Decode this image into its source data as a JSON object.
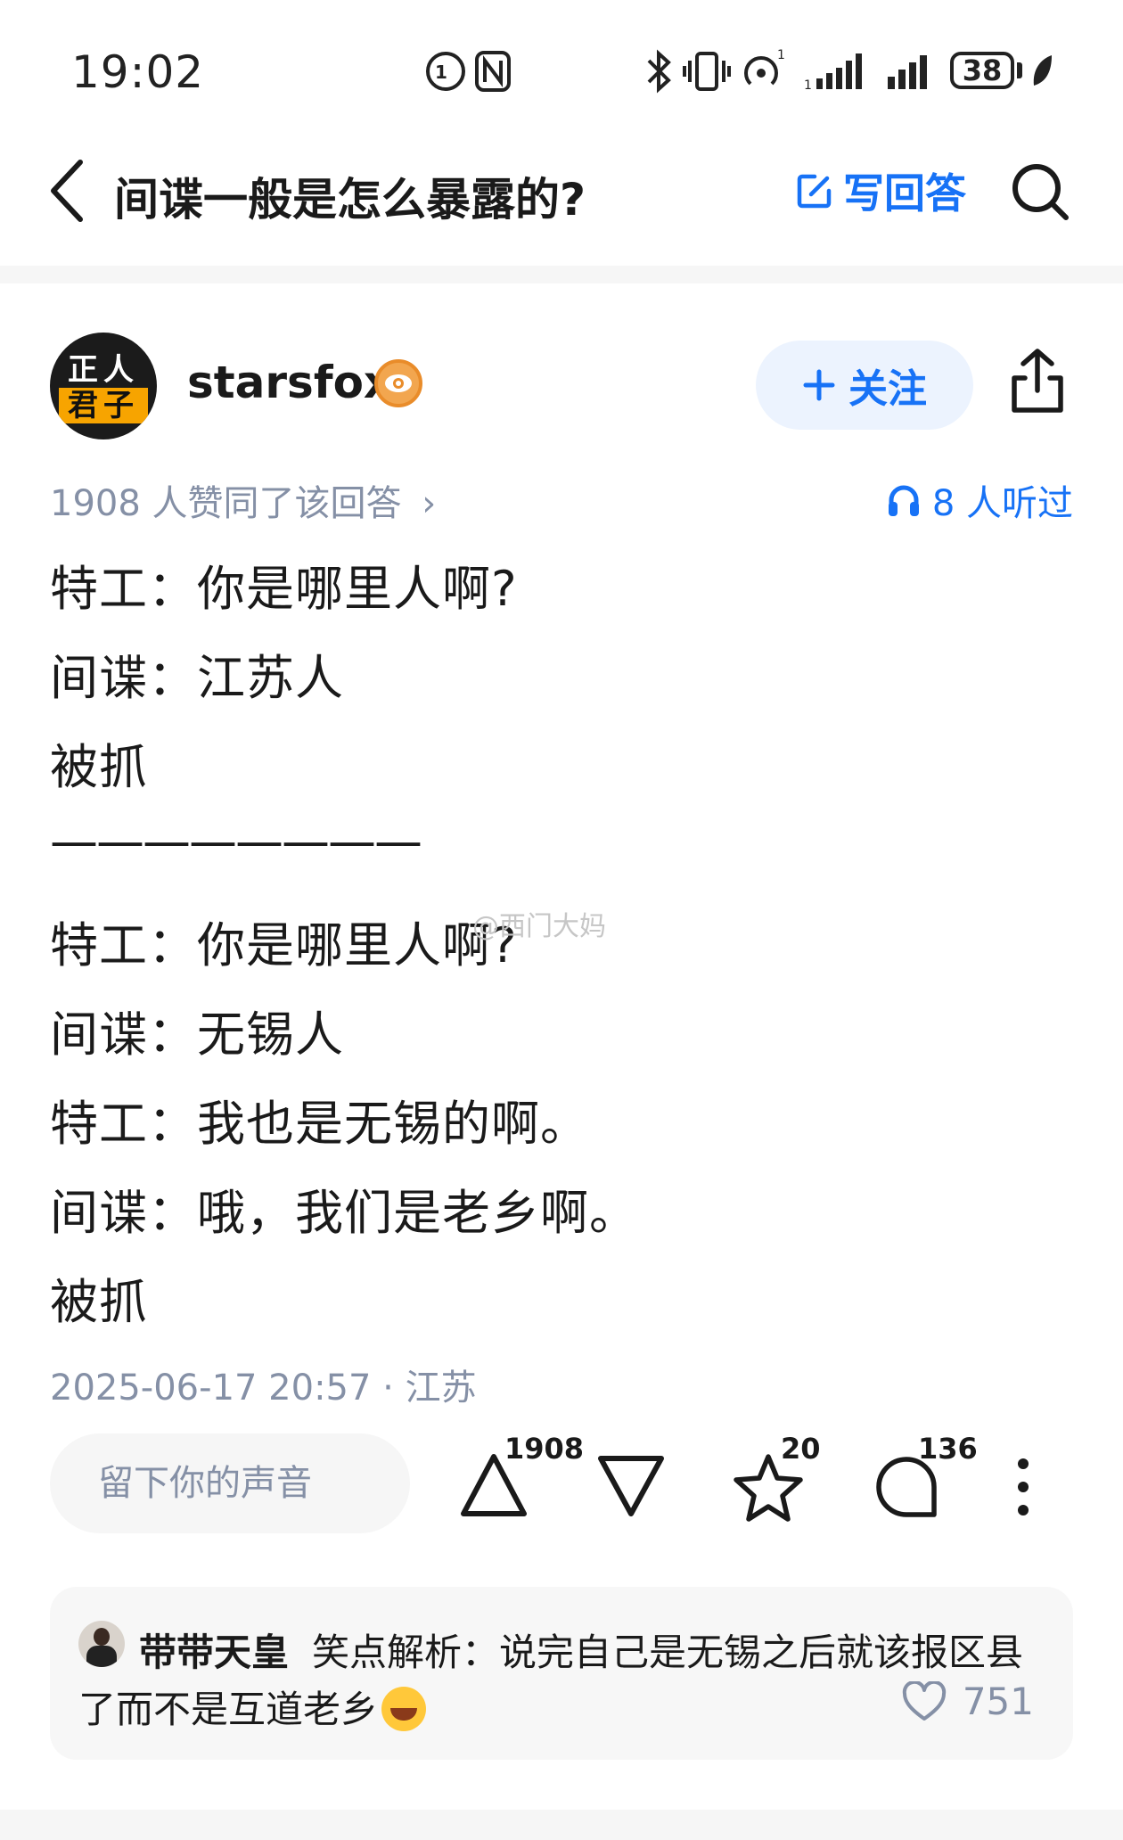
{
  "status_bar": {
    "time": "19:02",
    "battery": "38",
    "icons": [
      "hd-call-icon",
      "nfc-icon",
      "bluetooth-icon",
      "vibrate-icon",
      "hotspot-icon",
      "signal-1-icon",
      "signal-2-icon",
      "leaf-icon"
    ]
  },
  "header": {
    "back_icon": "chevron-left-icon",
    "title": "间谍一般是怎么暴露的?",
    "write_answer_label": "写回答",
    "search_icon": "search-icon"
  },
  "author": {
    "avatar_text_top": "正人",
    "avatar_text_bottom": "君子",
    "name": "starsfox",
    "follow_label": "关注",
    "share_icon": "share-icon"
  },
  "meta": {
    "approve_text": "1908 人赞同了该回答",
    "chevron": "›",
    "listen_text": "8 人听过"
  },
  "content": {
    "lines": [
      "特工：你是哪里人啊?",
      "间谍：江苏人",
      "被抓",
      "————————",
      "特工：你是哪里人啊?",
      "间谍：无锡人",
      "特工：我也是无锡的啊。",
      "间谍：哦，我们是老乡啊。",
      "被抓"
    ],
    "watermark": "@西门大妈"
  },
  "post": {
    "date": "2025-06-17 20:57",
    "location": "江苏"
  },
  "actions": {
    "comment_placeholder": "留下你的声音",
    "upvote_count": "1908",
    "favorite_count": "20",
    "comment_count": "136"
  },
  "featured_comment": {
    "user": "带带天皇",
    "text_line1": "笑点解析：说完自己是无锡之后就该报区县",
    "text_line2": "了而不是互道老乡",
    "likes": "751"
  },
  "colors": {
    "accent": "#1772f6",
    "muted": "#8590a6",
    "band": "#f6f6f6"
  }
}
